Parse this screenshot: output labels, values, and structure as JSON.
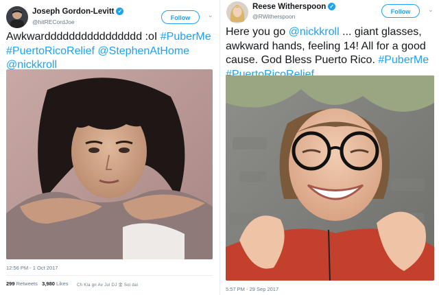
{
  "tweets": [
    {
      "author": "Joseph Gordon-Levitt",
      "handle": "@hitRECordJoe",
      "follow_label": "Follow",
      "text_main": "Awkwardddddddddddddddd :oI ",
      "hashtag_1": "#PuberMe",
      "hashtag_2": "#PuertoRicoRelief",
      "mention_1": "@StephenAtHome",
      "mention_2": "@nickkroll",
      "timestamp": "12:56 PM - 1 Oct 2017",
      "retweets_count": "299",
      "retweets_label": "Retweets",
      "likes_count": "3,980",
      "likes_label": "Likes",
      "likers": "Ch   Kla   gn   Av   Jul   DJ   金   Soi   dai"
    },
    {
      "author": "Reese Witherspoon",
      "handle": "@RWitherspoon",
      "follow_label": "Follow",
      "text_mention": "@nickkroll",
      "text_pre": "Here you go ",
      "text_body": " ... giant glasses, awkward hands, feeling 14! All for a good cause. God Bless Puerto Rico. ",
      "hashtag_1": "#PuberMe",
      "hashtag_2": "#PuertoRicoRelief",
      "timestamp": "5:57 PM - 29 Sep 2017"
    }
  ],
  "icons": [
    "verified-badge-icon",
    "chevron-down-icon"
  ],
  "colors": {
    "link": "#1da1f2",
    "muted": "#657786",
    "text": "#14171a"
  }
}
